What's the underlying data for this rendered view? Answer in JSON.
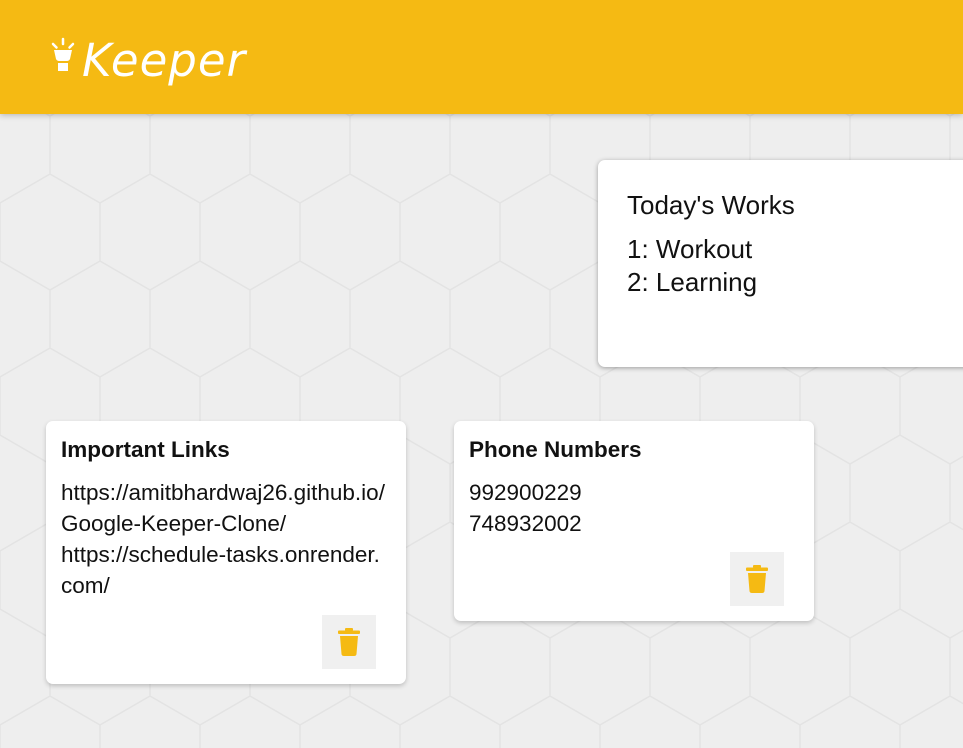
{
  "header": {
    "app_name": "Keeper"
  },
  "create_note": {
    "title": "Today's Works",
    "content_lines": [
      "1: Workout",
      "2: Learning"
    ]
  },
  "notes": [
    {
      "title": "Important Links",
      "content_lines": [
        "https://amitbhardwaj26.github.io/Google-Keeper-Clone/",
        "https://schedule-tasks.onrender.com/"
      ]
    },
    {
      "title": "Phone Numbers",
      "content_lines": [
        "992900229",
        "748932002"
      ]
    }
  ],
  "icons": {
    "logo": "lightbulb-icon",
    "delete": "trash-icon"
  },
  "colors": {
    "accent": "#f5ba13",
    "background": "#eeeeee",
    "card": "#ffffff"
  }
}
